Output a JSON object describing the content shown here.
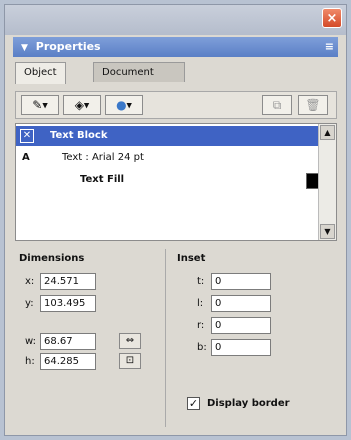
{
  "window": {
    "close_glyph": "×",
    "title": "Properties",
    "title_arrow": "▼",
    "menu_glyph": "≡"
  },
  "tabs": [
    {
      "label": "Object",
      "active": true
    },
    {
      "label": "Document",
      "active": false
    }
  ],
  "toolbar": {
    "buttons": [
      {
        "icon": "pencil-icon",
        "glyph": "✎"
      },
      {
        "icon": "paint-bucket-icon",
        "glyph": "◈"
      },
      {
        "icon": "effects-icon",
        "glyph": "●"
      }
    ],
    "right_buttons": [
      {
        "icon": "copy-icon",
        "glyph": "⧉"
      },
      {
        "icon": "trash-icon",
        "glyph": "🗑"
      }
    ]
  },
  "attributes": {
    "items": [
      {
        "icon": "text-block-icon",
        "label": "Text Block",
        "selected": true
      },
      {
        "icon": "type-icon",
        "glyph": "A",
        "label": "Text : Arial 24 pt",
        "selected": false
      },
      {
        "icon": "none",
        "label": "Text Fill",
        "selected": false,
        "swatch": "#000000"
      }
    ]
  },
  "dimensions": {
    "label": "Dimensions",
    "x": {
      "label": "x:",
      "value": "24.571"
    },
    "y": {
      "label": "y:",
      "value": "103.495"
    },
    "w": {
      "label": "w:",
      "value": "68.67"
    },
    "h": {
      "label": "h:",
      "value": "64.285"
    }
  },
  "inset": {
    "label": "Inset",
    "t": {
      "label": "t:",
      "value": "0"
    },
    "l": {
      "label": "l:",
      "value": "0"
    },
    "r": {
      "label": "r:",
      "value": "0"
    },
    "b": {
      "label": "b:",
      "value": "0"
    }
  },
  "display_border": {
    "label": "Display border",
    "checked": true,
    "mark": "✓"
  }
}
